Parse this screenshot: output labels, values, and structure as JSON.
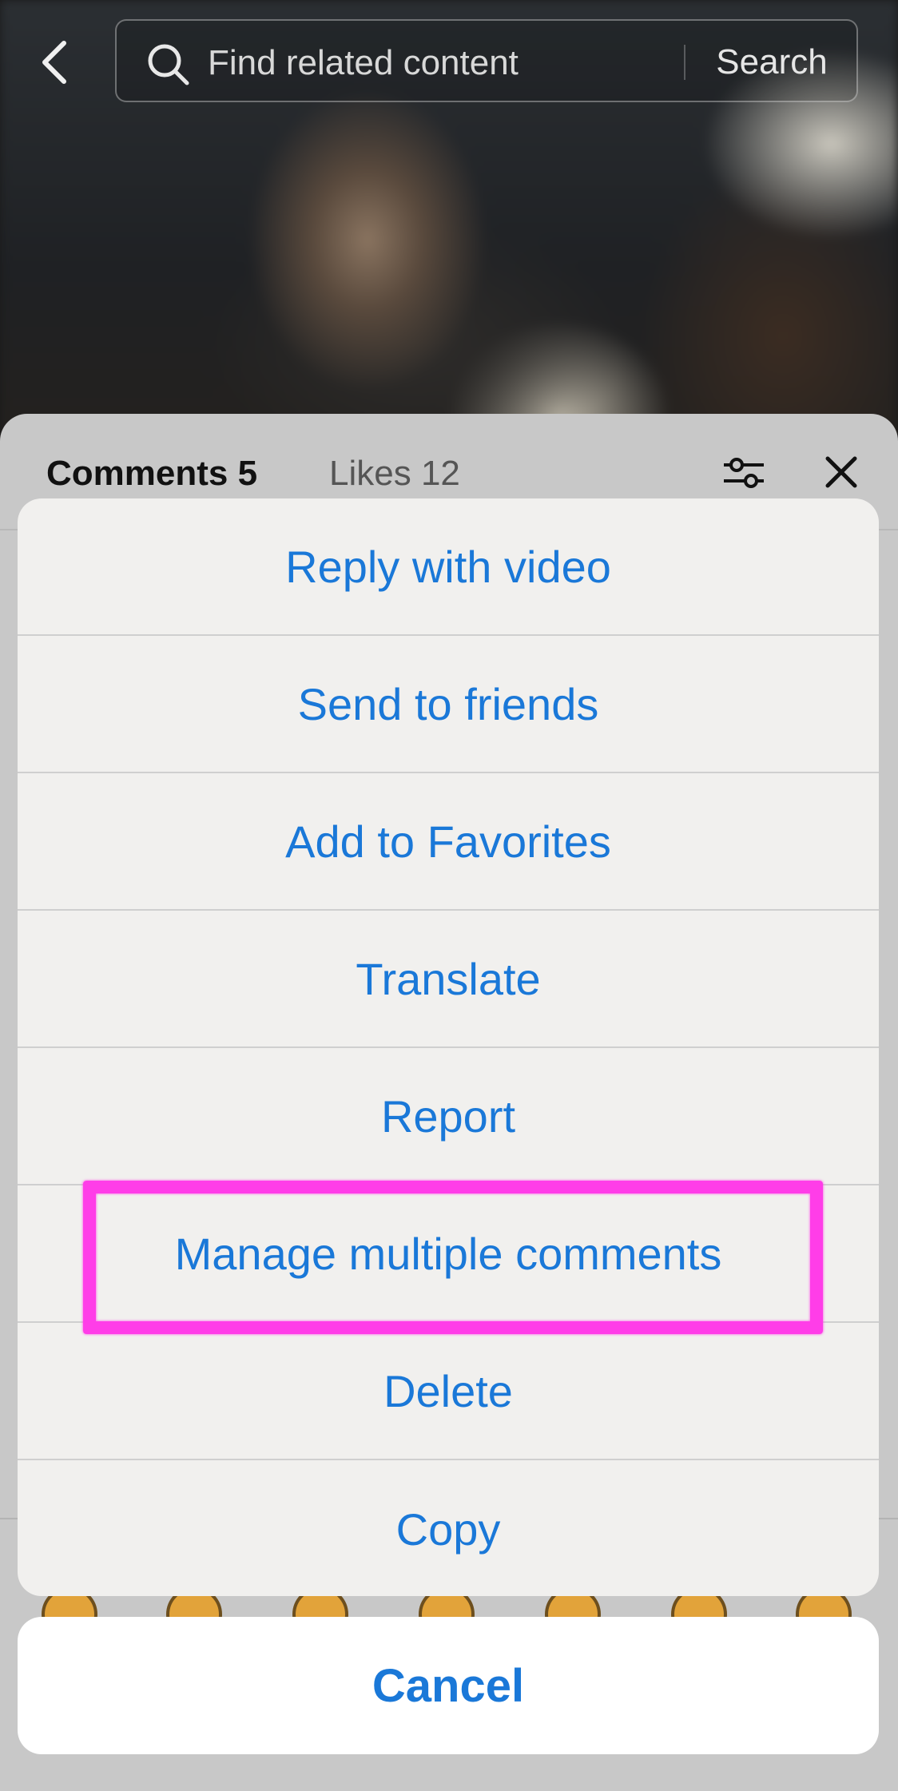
{
  "search": {
    "placeholder": "Find related content",
    "button_label": "Search"
  },
  "panel": {
    "comments_tab": "Comments 5",
    "likes_tab": "Likes 12"
  },
  "action_sheet": {
    "items": [
      {
        "label": "Reply with video"
      },
      {
        "label": "Send to friends"
      },
      {
        "label": "Add to Favorites"
      },
      {
        "label": "Translate"
      },
      {
        "label": "Report"
      },
      {
        "label": "Manage multiple comments",
        "highlighted": true
      },
      {
        "label": "Delete"
      },
      {
        "label": "Copy"
      }
    ],
    "cancel_label": "Cancel"
  },
  "colors": {
    "accent": "#1a78d8",
    "highlight": "#ff3de8"
  },
  "icons": [
    "back-icon",
    "search-icon",
    "filter-icon",
    "close-icon"
  ]
}
